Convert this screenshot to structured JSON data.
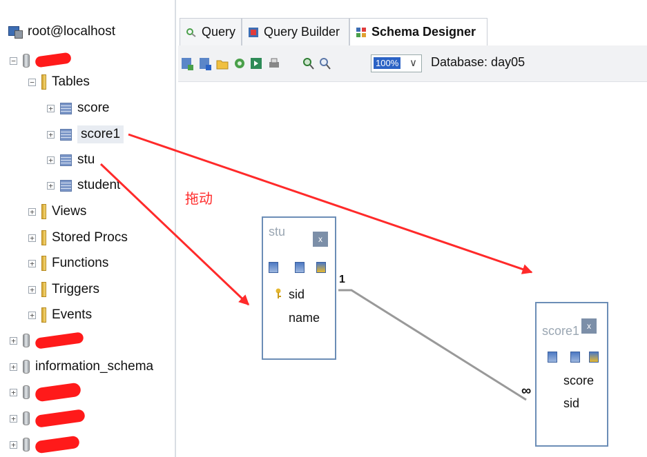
{
  "tree": {
    "server": "root@localhost",
    "tables_label": "Tables",
    "tables": [
      "score",
      "score1",
      "stu",
      "student"
    ],
    "folders": [
      "Views",
      "Stored Procs",
      "Functions",
      "Triggers",
      "Events"
    ],
    "other_dbs": [
      "information_schema"
    ]
  },
  "tabs": [
    "Query",
    "Query Builder",
    "Schema Designer"
  ],
  "toolbar": {
    "zoom": "100%",
    "zoom_arrow": "∨",
    "database_label": "Database: day05"
  },
  "annotation": "拖动",
  "entities": {
    "stu": {
      "title": "stu",
      "close": "x",
      "fields": [
        "sid",
        "name"
      ]
    },
    "score1": {
      "title": "score1",
      "close": "x",
      "fields": [
        "score",
        "sid"
      ]
    }
  },
  "relation": {
    "one": "1",
    "many": "∞"
  },
  "colors": {
    "arrow": "#ff2a2a",
    "relation_line": "#999999",
    "selection": "#e8ecf2",
    "entity_border": "#6b8db6"
  }
}
